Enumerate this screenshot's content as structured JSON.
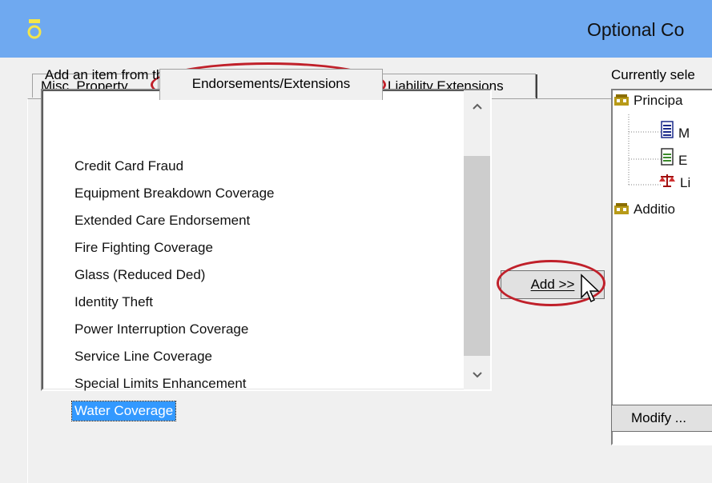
{
  "window": {
    "title": "Optional Co"
  },
  "tabs": [
    {
      "label": "Misc. Property",
      "selected": false
    },
    {
      "label": "Endorsements/Extensions",
      "selected": true
    },
    {
      "label": "Liability Extensions",
      "selected": false
    }
  ],
  "left_panel": {
    "label": "Add an item from this list...",
    "items": [
      "Credit Card Fraud",
      "Equipment Breakdown Coverage",
      "Extended Care Endorsement",
      "Fire Fighting Coverage",
      "Glass (Reduced Ded)",
      "Identity Theft",
      "Power Interruption Coverage",
      "Service Line Coverage",
      "Special Limits Enhancement",
      "Water Coverage"
    ],
    "selected_item": "Water Coverage"
  },
  "add_button": {
    "label": "Add >>"
  },
  "right_panel": {
    "label": "Currently sele",
    "tree": [
      {
        "label": "Principa",
        "icon": "building-icon",
        "level": 0
      },
      {
        "label": "M",
        "icon": "document-icon",
        "level": 1
      },
      {
        "label": "E",
        "icon": "document-icon",
        "level": 1
      },
      {
        "label": "Li",
        "icon": "scales-icon",
        "level": 1
      },
      {
        "label": "Additio",
        "icon": "building-icon",
        "level": 0
      }
    ]
  },
  "modify_button": {
    "label": "Modify ..."
  },
  "annotation_color": "#c0202a",
  "selection_color": "#3399ff",
  "titlebar_color": "#6fa9f0"
}
